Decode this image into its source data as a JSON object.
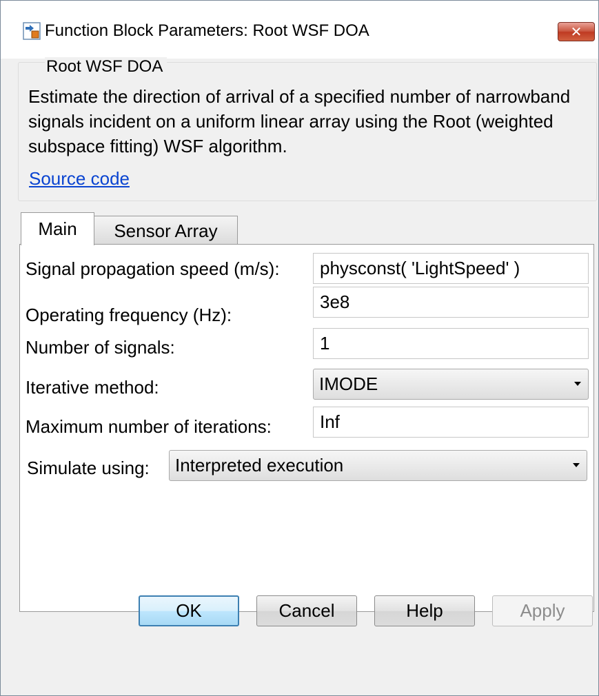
{
  "window": {
    "title": "Function Block Parameters: Root WSF DOA",
    "close_glyph": "✕"
  },
  "group": {
    "title": "Root WSF DOA",
    "description": "Estimate the direction of arrival of a specified number of narrowband signals incident on a uniform linear array using the Root (weighted subspace fitting) WSF algorithm.",
    "link": "Source code"
  },
  "tabs": [
    {
      "label": "Main",
      "selected": true
    },
    {
      "label": "Sensor Array",
      "selected": false
    }
  ],
  "params": {
    "speed_label": "Signal propagation speed (m/s):",
    "speed_value": "physconst( 'LightSpeed' )",
    "freq_label": "Operating frequency (Hz):",
    "freq_value": "3e8",
    "nsig_label": "Number of signals:",
    "nsig_value": "1",
    "method_label": "Iterative method:",
    "method_value": "IMODE",
    "maxiter_label": "Maximum number of iterations:",
    "maxiter_value": "Inf",
    "simulate_label": "Simulate using:",
    "simulate_value": "Interpreted execution"
  },
  "buttons": {
    "ok": "OK",
    "cancel": "Cancel",
    "help": "Help",
    "apply": "Apply"
  },
  "icons": {
    "title": "simulink-block-icon",
    "dropdown": "chevron-down-icon"
  }
}
